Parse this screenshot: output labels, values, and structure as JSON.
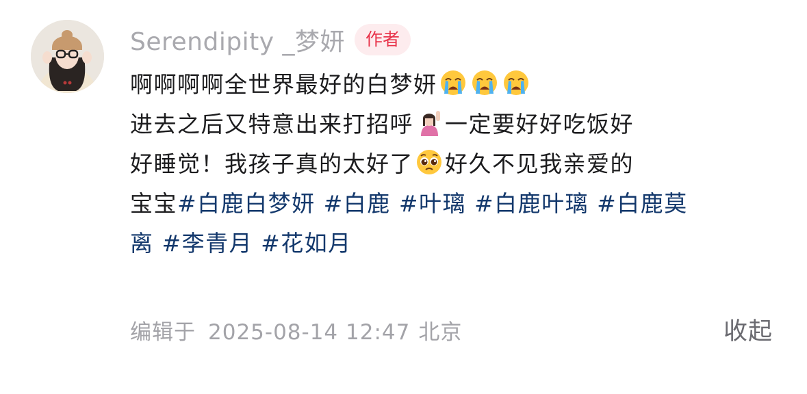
{
  "comment": {
    "username": "Serendipity _梦妍",
    "author_badge": "作者",
    "lines": [
      {
        "segments": [
          {
            "type": "text",
            "text": "啊啊啊啊全世界最好的白梦妍"
          },
          {
            "type": "emoji",
            "name": "loudly-crying-face-emoji"
          },
          {
            "type": "emoji",
            "name": "loudly-crying-face-emoji"
          },
          {
            "type": "emoji",
            "name": "loudly-crying-face-emoji"
          }
        ]
      },
      {
        "segments": [
          {
            "type": "text",
            "text": "进去之后又特意出来打招呼"
          },
          {
            "type": "emoji",
            "name": "person-raising-hand-emoji"
          },
          {
            "type": "text",
            "text": "一定要好好吃饭好"
          }
        ]
      },
      {
        "segments": [
          {
            "type": "text",
            "text": "好睡觉！我孩子真的太好了"
          },
          {
            "type": "emoji",
            "name": "pleading-face-emoji"
          },
          {
            "type": "text",
            "text": "好久不见我亲爱的"
          }
        ]
      },
      {
        "segments": [
          {
            "type": "text",
            "text": "宝宝"
          },
          {
            "type": "hashtag",
            "text": "#白鹿白梦妍"
          },
          {
            "type": "text",
            "text": " "
          },
          {
            "type": "hashtag",
            "text": "#白鹿"
          },
          {
            "type": "text",
            "text": " "
          },
          {
            "type": "hashtag",
            "text": "#叶璃"
          },
          {
            "type": "text",
            "text": " "
          },
          {
            "type": "hashtag",
            "text": "#白鹿叶璃"
          },
          {
            "type": "text",
            "text": " "
          },
          {
            "type": "hashtag",
            "text": "#白鹿莫"
          }
        ]
      },
      {
        "segments": [
          {
            "type": "hashtag",
            "text": "离"
          },
          {
            "type": "text",
            "text": " "
          },
          {
            "type": "hashtag",
            "text": "#李青月"
          },
          {
            "type": "text",
            "text": " "
          },
          {
            "type": "hashtag",
            "text": "#花如月"
          }
        ]
      }
    ],
    "edited_label": "编辑于",
    "edited_time": "2025-08-14 12:47",
    "location": "北京",
    "collapse_label": "收起"
  },
  "colors": {
    "username": "#a9a9ae",
    "badge_bg": "#fdecee",
    "badge_text": "#e8334a",
    "hashtag": "#13386c",
    "body_text": "#1c1c1e",
    "meta_text": "#a3a3a8",
    "collapse_text": "#6a6a70"
  }
}
